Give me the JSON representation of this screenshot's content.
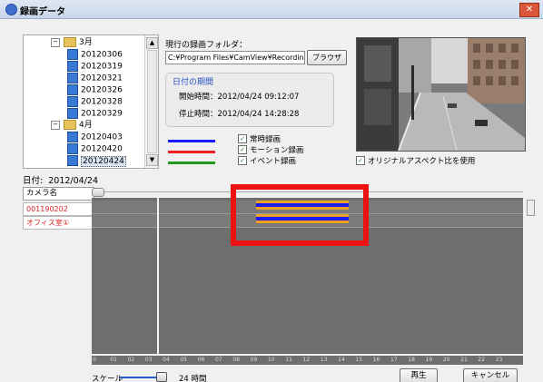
{
  "window": {
    "title": "録画データ",
    "close_glyph": "✕",
    "app_icon": "camera-app-icon"
  },
  "tree": {
    "items": [
      {
        "label": "3月",
        "kind": "month",
        "expander": "−"
      },
      {
        "label": "20120306",
        "kind": "day"
      },
      {
        "label": "20120319",
        "kind": "day"
      },
      {
        "label": "20120321",
        "kind": "day"
      },
      {
        "label": "20120326",
        "kind": "day"
      },
      {
        "label": "20120328",
        "kind": "day"
      },
      {
        "label": "20120329",
        "kind": "day"
      },
      {
        "label": "4月",
        "kind": "month",
        "expander": "−"
      },
      {
        "label": "20120403",
        "kind": "day"
      },
      {
        "label": "20120420",
        "kind": "day"
      },
      {
        "label": "20120424",
        "kind": "day",
        "selected": true
      }
    ],
    "scroll_up": "▲",
    "scroll_down": "▼"
  },
  "folder": {
    "label": "現行の録画フォルダ：",
    "path": "C:¥Program Files¥CamView¥Recording",
    "browse_label": "ブラウザ"
  },
  "date_range": {
    "caption": "日付の期間",
    "start_label": "開始時間：",
    "start_value": "2012/04/24 09:12:07",
    "end_label": "停止時間：",
    "end_value": "2012/04/24 14:28:28"
  },
  "legend": [
    {
      "label": "常時録画",
      "color": "#1a1aff",
      "checked": true
    },
    {
      "label": "モーション録画",
      "color": "#ee2020",
      "checked": true
    },
    {
      "label": "イベント録画",
      "color": "#1f9a1f",
      "checked": true
    }
  ],
  "aspect": {
    "label": "オリジナルアスペクト比を使用",
    "checked": true
  },
  "date_display": {
    "label": "日付:",
    "value": "2012/04/24"
  },
  "cameras": {
    "header": "カメラ名",
    "items": [
      "001190202",
      "オフィス室①"
    ]
  },
  "timeline": {
    "hours": [
      "0",
      "01",
      "02",
      "03",
      "04",
      "05",
      "06",
      "07",
      "08",
      "09",
      "10",
      "11",
      "12",
      "13",
      "14",
      "15",
      "16",
      "17",
      "18",
      "19",
      "20",
      "21",
      "22",
      "23"
    ],
    "segments": [
      {
        "camera": 0,
        "start_hour": 9.2,
        "end_hour": 14.47,
        "type": "常時録画",
        "color": "#1c1cf0",
        "outline": "#f0a020"
      },
      {
        "camera": 1,
        "start_hour": 9.2,
        "end_hour": 14.47,
        "type": "常時録画",
        "color": "#1c1cf0",
        "outline": "#f0a020"
      }
    ],
    "cursor_hour": 3.5
  },
  "scale": {
    "label": "スケール",
    "value": "24 時間"
  },
  "buttons": {
    "play": "再生",
    "cancel": "キャンセル"
  }
}
